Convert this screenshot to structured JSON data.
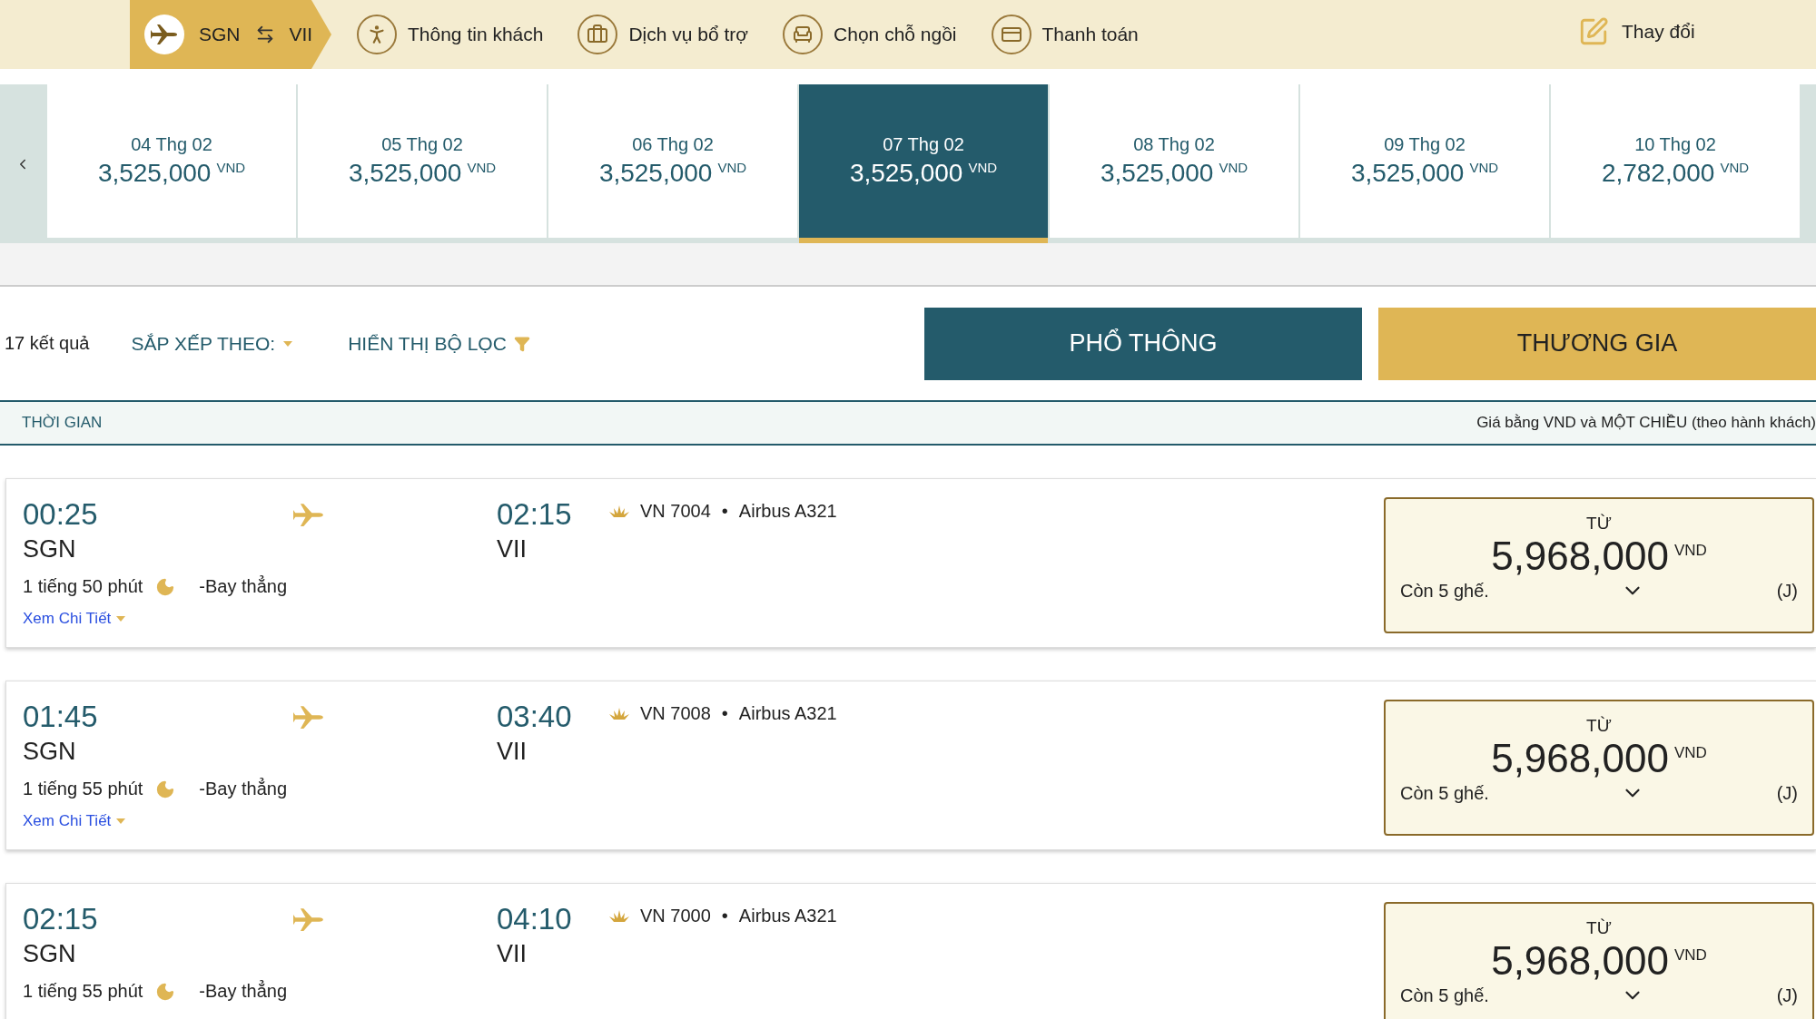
{
  "steps": [
    {
      "kind": "route",
      "from": "SGN",
      "to": "VII",
      "selected": true
    },
    {
      "kind": "passenger",
      "label": "Thông tin khách",
      "selected": false
    },
    {
      "kind": "services",
      "label": "Dịch vụ bổ trợ",
      "selected": false
    },
    {
      "kind": "seat",
      "label": "Chọn chỗ ngồi",
      "selected": false
    },
    {
      "kind": "payment",
      "label": "Thanh toán",
      "selected": false
    }
  ],
  "change_link": "Thay đổi",
  "dates": [
    {
      "date": "04 Thg 02",
      "price": "3,525,000",
      "currency": "VND",
      "selected": false
    },
    {
      "date": "05 Thg 02",
      "price": "3,525,000",
      "currency": "VND",
      "selected": false
    },
    {
      "date": "06 Thg 02",
      "price": "3,525,000",
      "currency": "VND",
      "selected": false
    },
    {
      "date": "07 Thg 02",
      "price": "3,525,000",
      "currency": "VND",
      "selected": true
    },
    {
      "date": "08 Thg 02",
      "price": "3,525,000",
      "currency": "VND",
      "selected": false
    },
    {
      "date": "09 Thg 02",
      "price": "3,525,000",
      "currency": "VND",
      "selected": false
    },
    {
      "date": "10 Thg 02",
      "price": "2,782,000",
      "currency": "VND",
      "selected": false
    }
  ],
  "results_count": "17 kết quả",
  "sort_label": "SẮP XẾP THEO:",
  "filter_label": "HIỂN THỊ BỘ LỌC",
  "fare_tabs": [
    {
      "label": "PHỔ THÔNG",
      "selected": true
    },
    {
      "label": "THƯƠNG GIA",
      "selected": false
    }
  ],
  "table_header": {
    "left": "THỜI GIAN",
    "right": "Giá bằng VND và MỘT CHIỀU (theo hành khách)"
  },
  "flights": [
    {
      "depart_time": "00:25",
      "depart_airport": "SGN",
      "arrive_time": "02:15",
      "arrive_airport": "VII",
      "duration": "1 tiếng 50 phút",
      "stops": "-Bay thẳng",
      "flight_no": "VN 7004",
      "separator": "•",
      "aircraft": "Airbus A321",
      "details_link": "Xem Chi Tiết",
      "fare": {
        "label": "TỪ",
        "price": "5,968,000",
        "currency": "VND",
        "seats": "Còn 5 ghế.",
        "fare_class": "(J)"
      }
    },
    {
      "depart_time": "01:45",
      "depart_airport": "SGN",
      "arrive_time": "03:40",
      "arrive_airport": "VII",
      "duration": "1 tiếng 55 phút",
      "stops": "-Bay thẳng",
      "flight_no": "VN 7008",
      "separator": "•",
      "aircraft": "Airbus A321",
      "details_link": "Xem Chi Tiết",
      "fare": {
        "label": "TỪ",
        "price": "5,968,000",
        "currency": "VND",
        "seats": "Còn 5 ghế.",
        "fare_class": "(J)"
      }
    },
    {
      "depart_time": "02:15",
      "depart_airport": "SGN",
      "arrive_time": "04:10",
      "arrive_airport": "VII",
      "duration": "1 tiếng 55 phút",
      "stops": "-Bay thẳng",
      "flight_no": "VN 7000",
      "separator": "•",
      "aircraft": "Airbus A321",
      "fare": {
        "label": "TỪ",
        "price": "5,968,000",
        "currency": "VND",
        "seats": "Còn 5 ghế.",
        "fare_class": "(J)"
      }
    }
  ]
}
